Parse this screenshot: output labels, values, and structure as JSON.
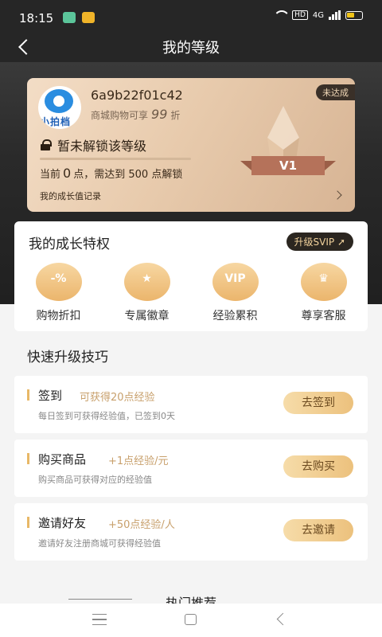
{
  "status_bar": {
    "time": "18:15",
    "hd": "HD",
    "network": "4G"
  },
  "nav": {
    "title": "我的等级"
  },
  "member_card": {
    "user_id": "6a9b22f01c42",
    "discount_prefix": "商城购物可享",
    "discount_value": "99",
    "discount_suffix": "折",
    "status_badge": "未达成",
    "lock_text": "暂未解锁该等级",
    "progress_fraction": 0,
    "points_prefix": "当前",
    "points_value": "0",
    "points_middle": "点，需达到",
    "points_target": "500",
    "points_suffix": "点解锁",
    "record_link": "我的成长值记录",
    "level": "V1",
    "avatar_text": "小拍档"
  },
  "privileges": {
    "title": "我的成长特权",
    "upgrade_button": "升级SVIP",
    "items": [
      {
        "label": "购物折扣",
        "icon": "discount-icon",
        "glyph": "-%"
      },
      {
        "label": "专属徽章",
        "icon": "medal-icon",
        "glyph": "★"
      },
      {
        "label": "经验累积",
        "icon": "vip-icon",
        "glyph": "VIP"
      },
      {
        "label": "尊享客服",
        "icon": "crown-icon",
        "glyph": "♛"
      }
    ]
  },
  "tips": {
    "title": "快速升级技巧",
    "tasks": [
      {
        "name": "签到",
        "gain": "可获得20点经验",
        "desc": "每日签到可获得经验值，已签到0天",
        "button": "去签到"
      },
      {
        "name": "购买商品",
        "gain": "+1点经验/元",
        "desc": "购买商品可获得对应的经验值",
        "button": "去购买"
      },
      {
        "name": "邀请好友",
        "gain": "+50点经验/人",
        "desc": "邀请好友注册商城可获得经验值",
        "button": "去邀请"
      }
    ]
  },
  "recommend": {
    "title": "热门推荐"
  },
  "colors": {
    "accent": "#e8b867",
    "dark": "#262626",
    "card": "#e8cbad"
  }
}
